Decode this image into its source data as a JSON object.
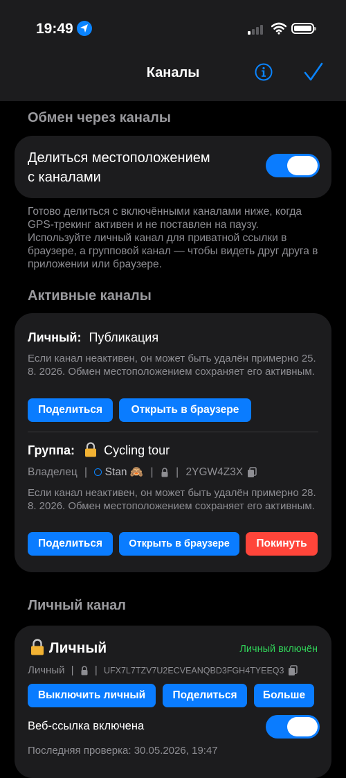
{
  "status": {
    "time": "19:49"
  },
  "nav": {
    "title": "Каналы"
  },
  "sharing": {
    "section": "Обмен через каналы",
    "toggle_label_1": "Делиться местоположением",
    "toggle_label_2": "с каналами",
    "enabled": true,
    "description": "Готово делиться с включёнными каналами ниже, когда GPS-трекинг активен и не поставлен на паузу. Используйте личный канал для приватной ссылки в браузере, а групповой канал — чтобы видеть друг друга в приложении или браузере."
  },
  "active": {
    "section": "Активные каналы",
    "personal": {
      "kind": "Личный:",
      "name": "Публикация",
      "note": "Если канал неактивен, он может быть удалён примерно 25. 8. 2026. Обмен местоположением сохраняет его активным.",
      "share": "Поделиться",
      "open": "Открыть в браузере"
    },
    "group": {
      "kind": "Группа:",
      "name": "Cycling tour",
      "owner": "Владелец",
      "sep": "|",
      "user": "Stan",
      "user_emoji": "🙈",
      "code": "2YGW4Z3X",
      "note": "Если канал неактивен, он может быть удалён примерно 28. 8. 2026. Обмен местоположением сохраняет его активным.",
      "share": "Поделиться",
      "open": "Открыть в браузере",
      "leave": "Покинуть"
    }
  },
  "personal_channel": {
    "section": "Личный канал",
    "title": "Личный",
    "status": "Личный включён",
    "label": "Личный",
    "sep": "|",
    "key": "UFX7L7TZV7U2ECVEANQBD3FGH4TYEEQ3",
    "disable": "Выключить личный",
    "share": "Поделиться",
    "more": "Больше",
    "weblink_label": "Веб-ссылка включена",
    "weblink_enabled": true,
    "last_check": "Последняя проверка: 30.05.2026, 19:47"
  },
  "colors": {
    "accent": "#0a84ff",
    "destructive": "#ff453a",
    "success": "#30d158",
    "dot": "#0a84ff"
  },
  "icons": [
    "location-arrow-icon",
    "signal-icon",
    "wifi-icon",
    "battery-icon",
    "info-icon",
    "checkmark-icon",
    "lock-icon",
    "copy-icon"
  ]
}
